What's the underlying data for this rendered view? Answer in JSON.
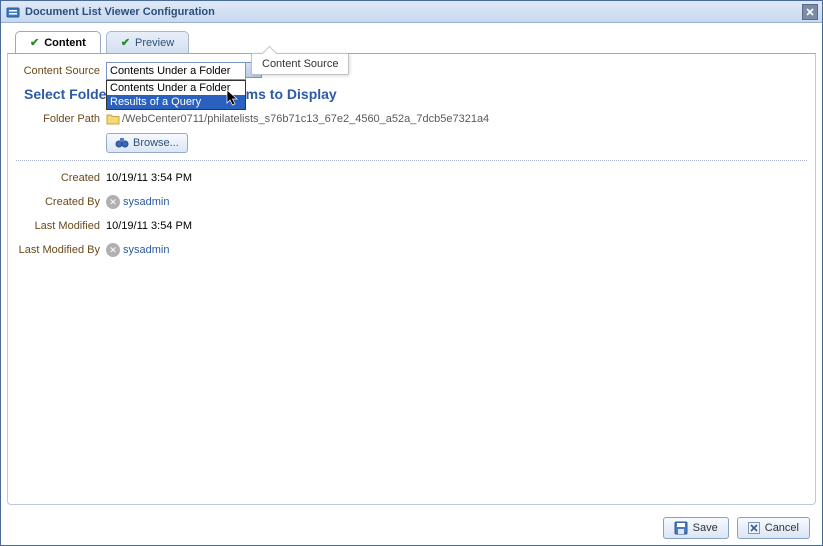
{
  "window": {
    "title": "Document List Viewer Configuration"
  },
  "tabs": {
    "content": "Content",
    "preview": "Preview"
  },
  "tooltip": "Content Source",
  "form": {
    "content_source_label": "Content Source",
    "content_source_value": "Contents Under a Folder",
    "options": [
      "Contents Under a Folder",
      "Results of a Query"
    ]
  },
  "section_title_prefix": "Select Folde",
  "section_title_suffix": "tent Items to Display",
  "folder": {
    "label": "Folder Path",
    "path": "/WebCenter0711/philatelists_s76b71c13_67e2_4560_a52a_7dcb5e7321a4",
    "browse": "Browse..."
  },
  "meta": {
    "created_label": "Created",
    "created_value": "10/19/11 3:54 PM",
    "createdby_label": "Created By",
    "createdby_value": "sysadmin",
    "modified_label": "Last Modified",
    "modified_value": "10/19/11 3:54 PM",
    "modifiedby_label": "Last Modified By",
    "modifiedby_value": "sysadmin"
  },
  "buttons": {
    "save": "Save",
    "cancel": "Cancel"
  }
}
